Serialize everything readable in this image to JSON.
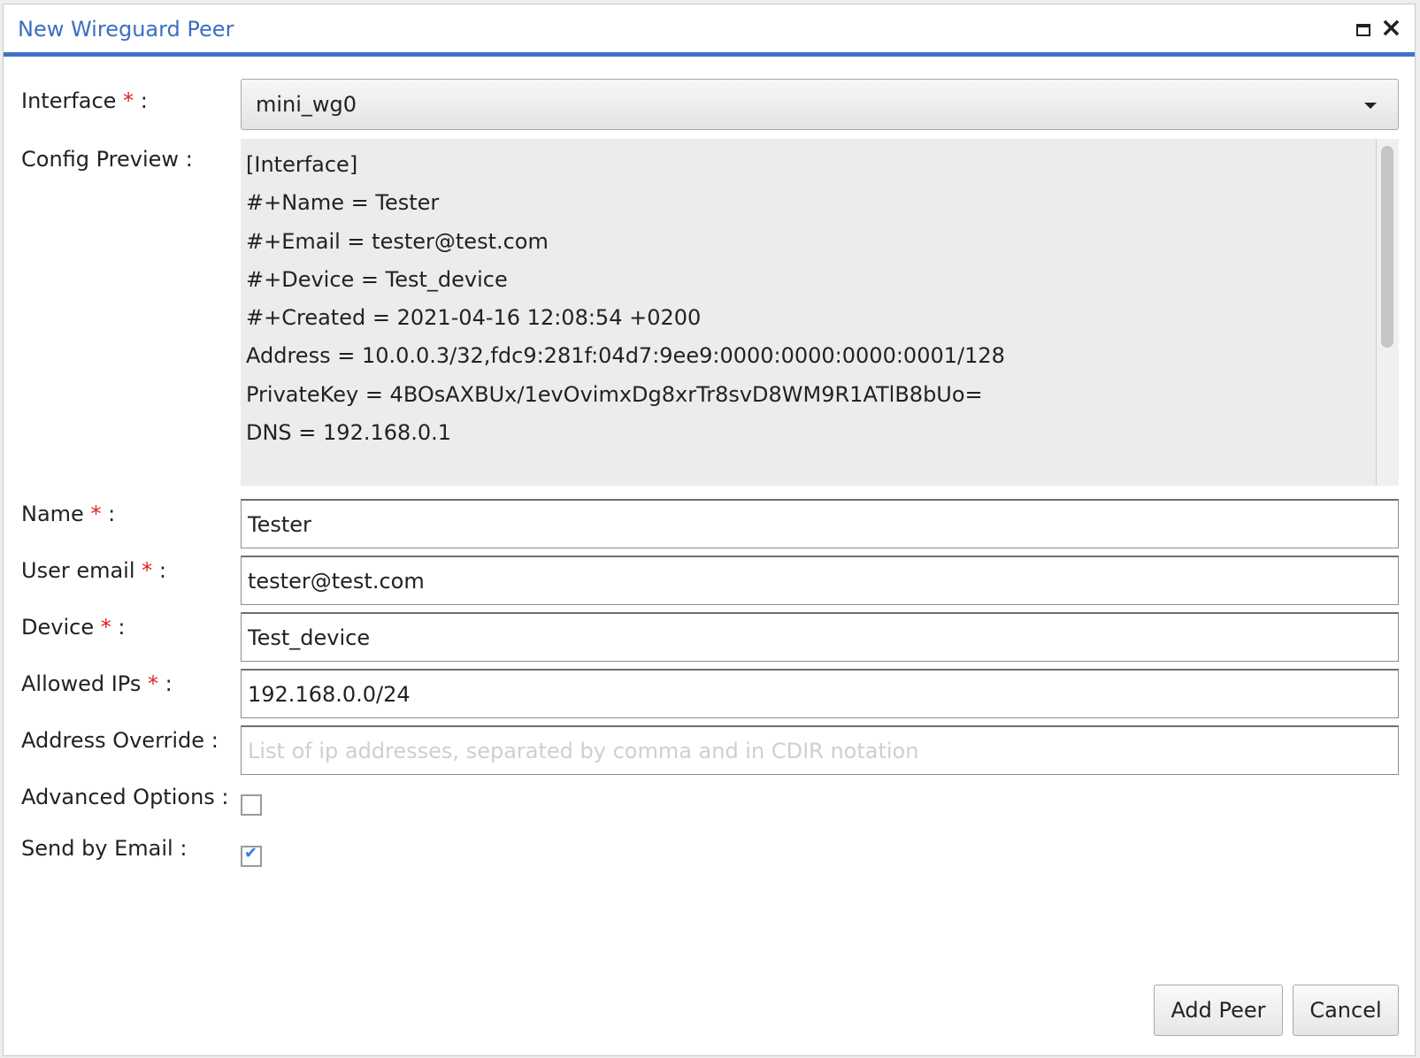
{
  "dialog": {
    "title": "New Wireguard Peer",
    "icons": {
      "maximize": "maximize-icon",
      "close": "close-icon"
    }
  },
  "form": {
    "interface": {
      "label": "Interface",
      "required_mark": "*",
      "colon": ":",
      "value": "mini_wg0"
    },
    "config_preview": {
      "label": "Config Preview",
      "colon": ":",
      "lines": [
        "[Interface]",
        "#+Name = Tester",
        "#+Email = tester@test.com",
        "#+Device = Test_device",
        "#+Created = 2021-04-16 12:08:54 +0200",
        "Address = 10.0.0.3/32,fdc9:281f:04d7:9ee9:0000:0000:0000:0001/128",
        "PrivateKey = 4BOsAXBUx/1evOvimxDg8xrTr8svD8WM9R1ATlB8bUo=",
        "DNS = 192.168.0.1"
      ]
    },
    "name": {
      "label": "Name",
      "required_mark": "*",
      "colon": ":",
      "value": "Tester"
    },
    "user_email": {
      "label": "User email",
      "required_mark": "*",
      "colon": ":",
      "value": "tester@test.com"
    },
    "device": {
      "label": "Device",
      "required_mark": "*",
      "colon": ":",
      "value": "Test_device"
    },
    "allowed_ips": {
      "label": "Allowed IPs",
      "required_mark": "*",
      "colon": ":",
      "value": "192.168.0.0/24"
    },
    "address_override": {
      "label": "Address Override",
      "colon": ":",
      "value": "",
      "placeholder": "List of ip addresses, separated by comma and in CDIR notation"
    },
    "advanced_options": {
      "label": "Advanced Options",
      "colon": ":",
      "checked": false
    },
    "send_by_email": {
      "label": "Send by Email",
      "colon": ":",
      "checked": true,
      "check_glyph": "✔"
    }
  },
  "buttons": {
    "add_peer": "Add Peer",
    "cancel": "Cancel"
  },
  "colors": {
    "accent": "#3d73c5",
    "title": "#3a6fc4",
    "required": "#e02020"
  }
}
